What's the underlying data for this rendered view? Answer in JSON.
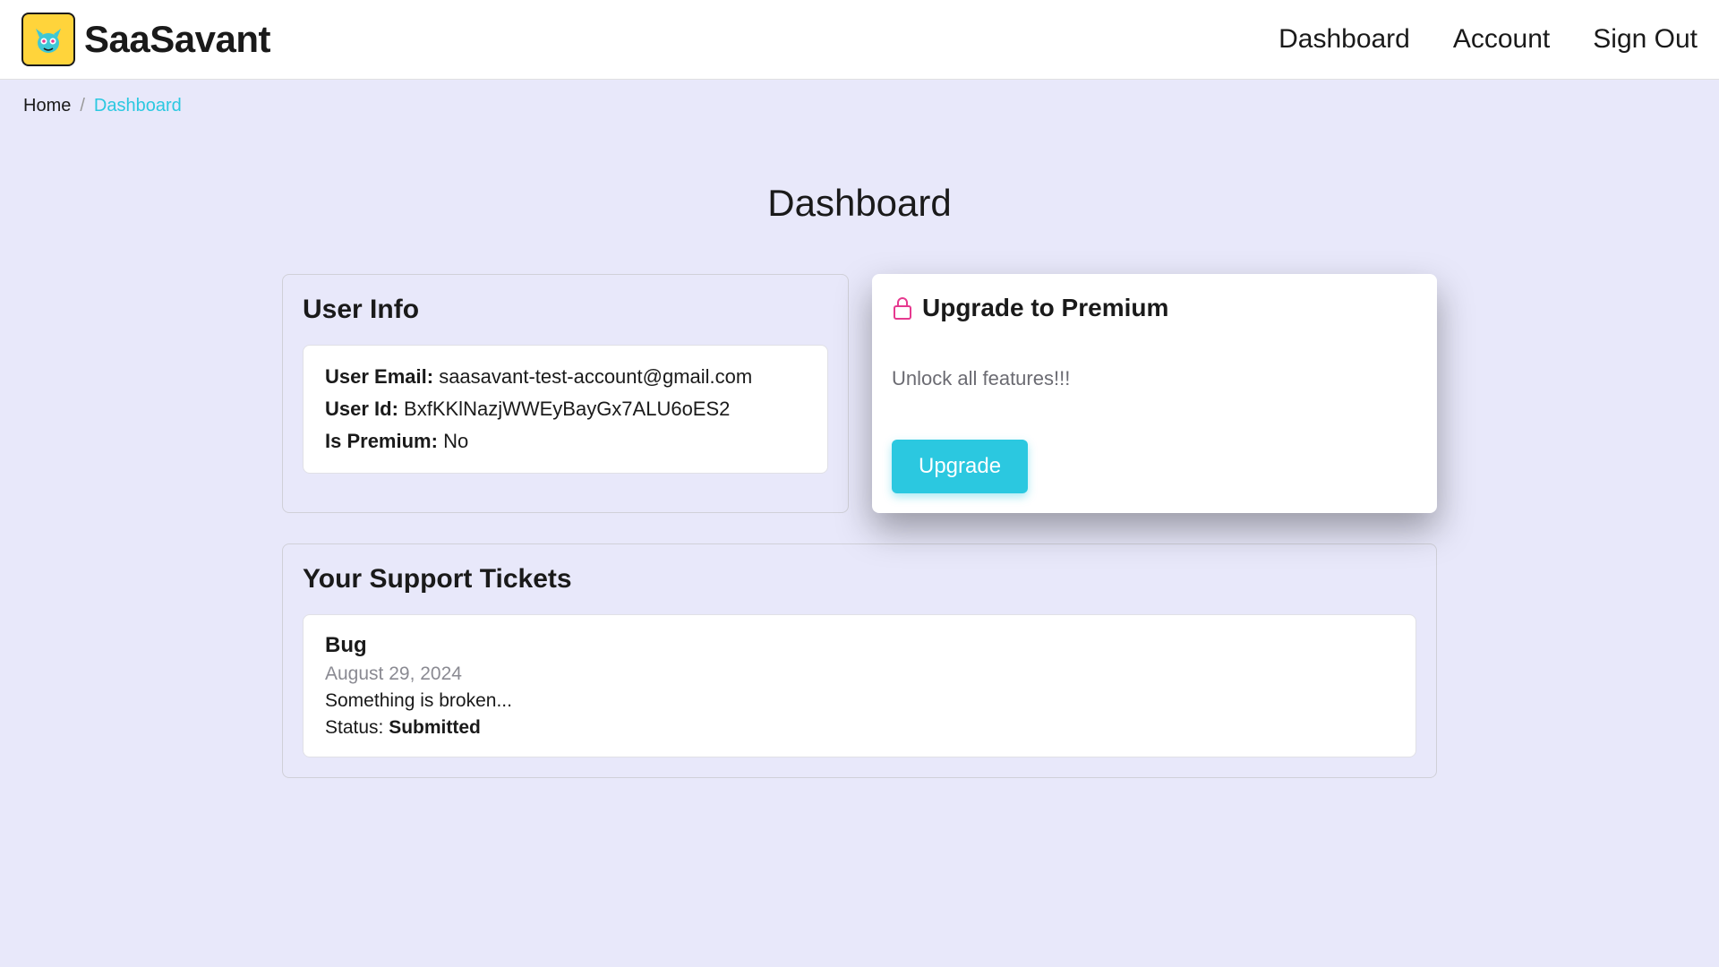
{
  "brand": {
    "name": "SaaSavant"
  },
  "nav": {
    "dashboard": "Dashboard",
    "account": "Account",
    "signout": "Sign Out"
  },
  "breadcrumb": {
    "home": "Home",
    "sep": "/",
    "current": "Dashboard"
  },
  "page": {
    "title": "Dashboard"
  },
  "user_info": {
    "title": "User Info",
    "email_label": "User Email:",
    "email_value": "saasavant-test-account@gmail.com",
    "id_label": "User Id:",
    "id_value": "BxfKKlNazjWWEyBayGx7ALU6oES2",
    "premium_label": "Is Premium:",
    "premium_value": "No"
  },
  "premium": {
    "title": "Upgrade to Premium",
    "description": "Unlock all features!!!",
    "button": "Upgrade"
  },
  "tickets": {
    "title": "Your Support Tickets",
    "items": [
      {
        "title": "Bug",
        "date": "August 29, 2024",
        "description": "Something is broken...",
        "status_label": "Status:",
        "status_value": "Submitted"
      }
    ]
  }
}
